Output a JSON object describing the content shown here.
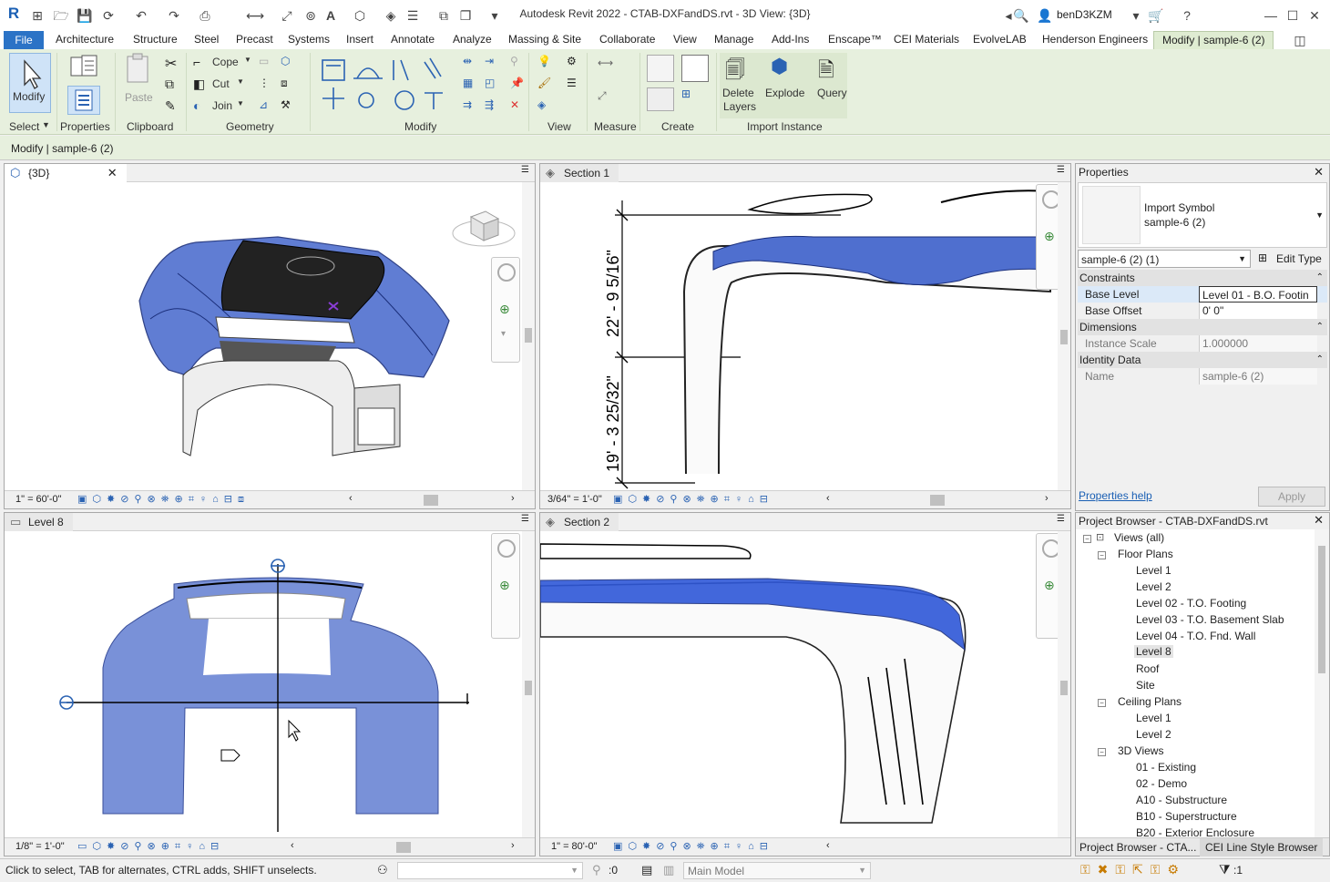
{
  "app": {
    "title": "Autodesk Revit 2022 - CTAB-DXFandDS.rvt - 3D View: {3D}",
    "user": "benD3KZM",
    "logo": "R"
  },
  "ribbon_tabs": [
    "File",
    "Architecture",
    "Structure",
    "Steel",
    "Precast",
    "Systems",
    "Insert",
    "Annotate",
    "Analyze",
    "Massing & Site",
    "Collaborate",
    "View",
    "Manage",
    "Add-Ins",
    "Enscape™",
    "CEI Materials",
    "EvolveLAB",
    "Henderson Engineers",
    "Modify | sample-6 (2)"
  ],
  "ribbon": {
    "modify_label": "Modify",
    "select_label": "Select",
    "properties_label": "Properties",
    "paste_label": "Paste",
    "clipboard_label": "Clipboard",
    "cope_label": "Cope",
    "cut_label": "Cut",
    "join_label": "Join",
    "geometry_label": "Geometry",
    "modify_panel_label": "Modify",
    "view_label": "View",
    "measure_label": "Measure",
    "create_label": "Create",
    "delete_layers_label_1": "Delete",
    "delete_layers_label_2": "Layers",
    "explode_label": "Explode",
    "query_label": "Query",
    "import_instance_label": "Import Instance"
  },
  "context_bar": {
    "text": "Modify | sample-6 (2)"
  },
  "views": {
    "v3d": {
      "tab": "{3D}",
      "scale": "1\" = 60'-0\""
    },
    "section1": {
      "tab": "Section 1",
      "scale": "3/64\" = 1'-0\"",
      "dim_upper": "22' - 9 5/16\"",
      "dim_lower": "19' - 3 25/32\""
    },
    "level8": {
      "tab": "Level 8",
      "scale": "1/8\" = 1'-0\""
    },
    "section2": {
      "tab": "Section 2",
      "scale": "1\" = 80'-0\""
    }
  },
  "properties": {
    "title": "Properties",
    "type_line1": "Import Symbol",
    "type_line2": "sample-6 (2)",
    "instance_select": "sample-6 (2) (1)",
    "edit_type": "Edit Type",
    "groups": {
      "constraints": "Constraints",
      "dimensions": "Dimensions",
      "identity": "Identity Data"
    },
    "rows": {
      "base_level_k": "Base Level",
      "base_level_v": "Level 01 - B.O. Footin",
      "base_offset_k": "Base Offset",
      "base_offset_v": "0'  0\"",
      "instance_scale_k": "Instance Scale",
      "instance_scale_v": "1.000000",
      "name_k": "Name",
      "name_v": "sample-6 (2)"
    },
    "help_link": "Properties help",
    "apply": "Apply"
  },
  "browser": {
    "title": "Project Browser - CTAB-DXFandDS.rvt",
    "views_all": "Views (all)",
    "floor_plans": "Floor Plans",
    "floor_items": [
      "Level 1",
      "Level 2",
      "Level 02 - T.O. Footing",
      "Level 03 - T.O. Basement Slab",
      "Level 04 - T.O. Fnd. Wall",
      "Level 8",
      "Roof",
      "Site"
    ],
    "ceiling_plans": "Ceiling Plans",
    "ceiling_items": [
      "Level 1",
      "Level 2"
    ],
    "views_3d": "3D Views",
    "views_3d_items": [
      "01 - Existing",
      "02 - Demo",
      "A10 - Substructure",
      "B10 - Superstructure",
      "B20 - Exterior Enclosure"
    ],
    "bottom_tab_1": "Project Browser - CTA...",
    "bottom_tab_2": "CEI Line Style Browser"
  },
  "status": {
    "hint": "Click to select, TAB for alternates, CTRL adds, SHIFT unselects.",
    "zero": ":0",
    "model": "Main Model",
    "filter_count": ":1"
  },
  "colors": {
    "accent": "#2b73c6",
    "ribbon_bg": "#e7f0de",
    "selection_blue": "#4f6fcf"
  }
}
